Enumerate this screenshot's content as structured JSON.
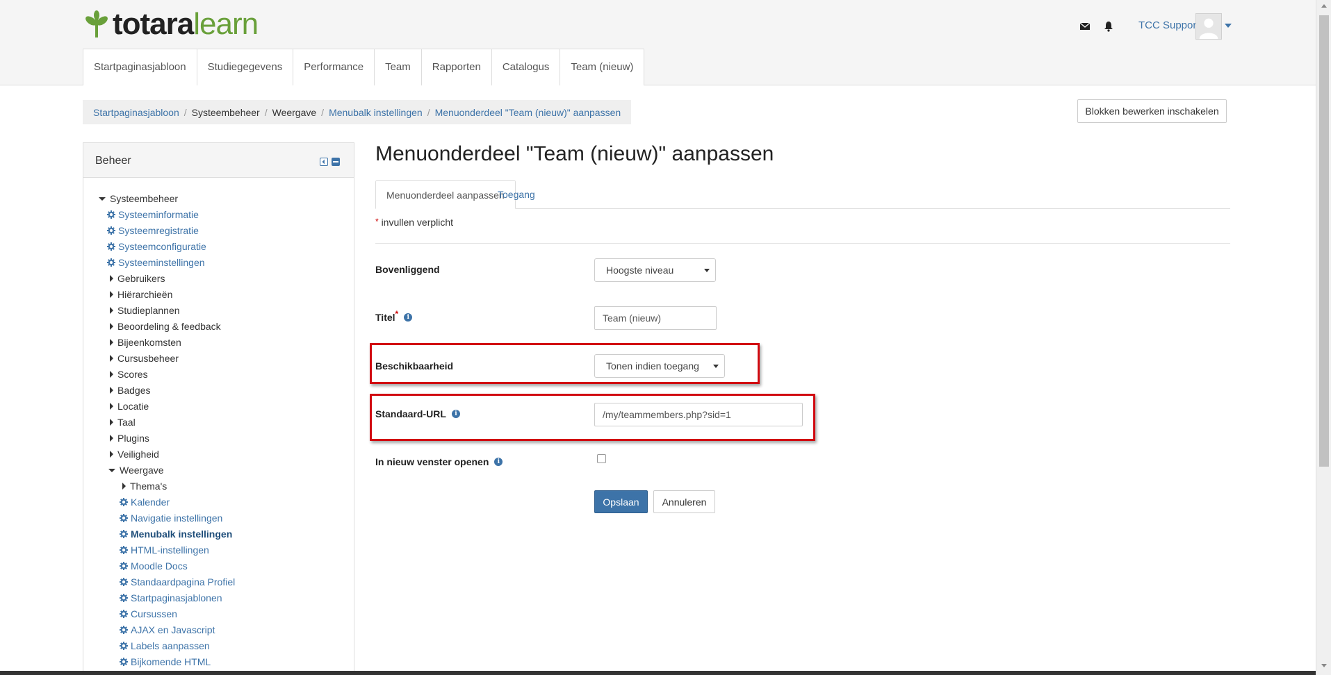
{
  "brand": {
    "part1": "totara",
    "part2": "learn"
  },
  "colors": {
    "accent": "#3d73a8",
    "brand_green": "#69a03a",
    "highlight": "#d10a11",
    "required": "#cc0000"
  },
  "header": {
    "mail_icon": "envelope-icon",
    "bell_icon": "bell-icon",
    "user_name": "TCC Support",
    "avatar_icon": "user-avatar-icon"
  },
  "nav": {
    "items": [
      {
        "label": "Startpaginasjabloon"
      },
      {
        "label": "Studiegegevens"
      },
      {
        "label": "Performance"
      },
      {
        "label": "Team"
      },
      {
        "label": "Rapporten"
      },
      {
        "label": "Catalogus"
      },
      {
        "label": "Team (nieuw)"
      }
    ]
  },
  "breadcrumb": [
    {
      "label": "Startpaginasjabloon",
      "link": true
    },
    {
      "label": "Systeembeheer",
      "link": false
    },
    {
      "label": "Weergave",
      "link": false
    },
    {
      "label": "Menubalk instellingen",
      "link": true
    },
    {
      "label": "Menuonderdeel \"Team (nieuw)\" aanpassen",
      "link": true
    }
  ],
  "blocks_button": "Blokken bewerken inschakelen",
  "admin_block": {
    "title": "Beheer",
    "tree": [
      {
        "label": "Systeembeheer",
        "type": "expanded",
        "level": 0,
        "style": "plain"
      },
      {
        "label": "Systeeminformatie",
        "type": "gear",
        "level": 1,
        "style": "lnk"
      },
      {
        "label": "Systeemregistratie",
        "type": "gear",
        "level": 1,
        "style": "lnk"
      },
      {
        "label": "Systeemconfiguratie",
        "type": "gear",
        "level": 1,
        "style": "lnk"
      },
      {
        "label": "Systeeminstellingen",
        "type": "gear",
        "level": 1,
        "style": "lnk"
      },
      {
        "label": "Gebruikers",
        "type": "collapsed",
        "level": 1,
        "style": "plain"
      },
      {
        "label": "Hiërarchieën",
        "type": "collapsed",
        "level": 1,
        "style": "plain"
      },
      {
        "label": "Studieplannen",
        "type": "collapsed",
        "level": 1,
        "style": "plain"
      },
      {
        "label": "Beoordeling & feedback",
        "type": "collapsed",
        "level": 1,
        "style": "plain"
      },
      {
        "label": "Bijeenkomsten",
        "type": "collapsed",
        "level": 1,
        "style": "plain"
      },
      {
        "label": "Cursusbeheer",
        "type": "collapsed",
        "level": 1,
        "style": "plain"
      },
      {
        "label": "Scores",
        "type": "collapsed",
        "level": 1,
        "style": "plain"
      },
      {
        "label": "Badges",
        "type": "collapsed",
        "level": 1,
        "style": "plain"
      },
      {
        "label": "Locatie",
        "type": "collapsed",
        "level": 1,
        "style": "plain"
      },
      {
        "label": "Taal",
        "type": "collapsed",
        "level": 1,
        "style": "plain"
      },
      {
        "label": "Plugins",
        "type": "collapsed",
        "level": 1,
        "style": "plain"
      },
      {
        "label": "Veiligheid",
        "type": "collapsed",
        "level": 1,
        "style": "plain"
      },
      {
        "label": "Weergave",
        "type": "expanded",
        "level": 1,
        "style": "plain"
      },
      {
        "label": "Thema's",
        "type": "collapsed",
        "level": 2,
        "style": "plain"
      },
      {
        "label": "Kalender",
        "type": "gear",
        "level": 2,
        "style": "lnk"
      },
      {
        "label": "Navigatie instellingen",
        "type": "gear",
        "level": 2,
        "style": "lnk"
      },
      {
        "label": "Menubalk instellingen",
        "type": "gear",
        "level": 2,
        "style": "bold"
      },
      {
        "label": "HTML-instellingen",
        "type": "gear",
        "level": 2,
        "style": "lnk"
      },
      {
        "label": "Moodle Docs",
        "type": "gear",
        "level": 2,
        "style": "lnk"
      },
      {
        "label": "Standaardpagina Profiel",
        "type": "gear",
        "level": 2,
        "style": "lnk"
      },
      {
        "label": "Startpaginasjablonen",
        "type": "gear",
        "level": 2,
        "style": "lnk"
      },
      {
        "label": "Cursussen",
        "type": "gear",
        "level": 2,
        "style": "lnk"
      },
      {
        "label": "AJAX en Javascript",
        "type": "gear",
        "level": 2,
        "style": "lnk"
      },
      {
        "label": "Labels aanpassen",
        "type": "gear",
        "level": 2,
        "style": "lnk"
      },
      {
        "label": "Bijkomende HTML",
        "type": "gear",
        "level": 2,
        "style": "lnk"
      }
    ]
  },
  "page": {
    "title": "Menuonderdeel \"Team (nieuw)\" aanpassen",
    "tabs": [
      {
        "label": "Menuonderdeel aanpassen"
      },
      {
        "label": "Toegang"
      }
    ],
    "required_note": "invullen verplicht",
    "required_mark": "*"
  },
  "form": {
    "parent_label": "Bovenliggend",
    "parent_value": "Hoogste niveau",
    "title_label": "Titel",
    "title_value": "Team (nieuw)",
    "visibility_label": "Beschikbaarheid",
    "visibility_value": "Tonen indien toegang",
    "url_label": "Standaard-URL",
    "url_value": "/my/teammembers.php?sid=1",
    "newwindow_label": "In nieuw venster openen",
    "newwindow_checked": false,
    "save_label": "Opslaan",
    "cancel_label": "Annuleren"
  }
}
